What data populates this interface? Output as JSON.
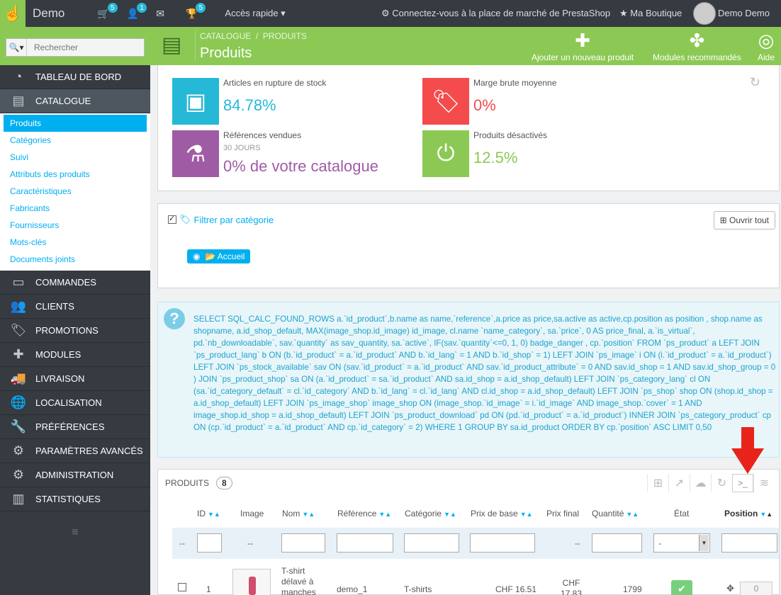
{
  "topbar": {
    "brand": "Demo",
    "cart_count": "5",
    "customers_count": "1",
    "trophy_count": "5",
    "quick_access": "Accès rapide",
    "marketplace": "Connectez-vous à la place de marché de PrestaShop",
    "my_shop": "Ma Boutique",
    "user": "Demo Demo"
  },
  "sidebar": {
    "search_placeholder": "Rechercher",
    "items": [
      {
        "label": "TABLEAU DE BORD",
        "icon": "dashboard-icon"
      },
      {
        "label": "CATALOGUE",
        "icon": "book-icon"
      },
      {
        "label": "COMMANDES",
        "icon": "credit-card-icon"
      },
      {
        "label": "CLIENTS",
        "icon": "users-icon"
      },
      {
        "label": "PROMOTIONS",
        "icon": "tags-icon"
      },
      {
        "label": "MODULES",
        "icon": "puzzle-icon"
      },
      {
        "label": "LIVRAISON",
        "icon": "truck-icon"
      },
      {
        "label": "LOCALISATION",
        "icon": "globe-icon"
      },
      {
        "label": "PRÉFÉRENCES",
        "icon": "wrench-icon"
      },
      {
        "label": "PARAMÈTRES AVANCÉS",
        "icon": "gears-icon"
      },
      {
        "label": "ADMINISTRATION",
        "icon": "gear-icon"
      },
      {
        "label": "STATISTIQUES",
        "icon": "bar-chart-icon"
      }
    ],
    "catalogue_sub": [
      "Produits",
      "Catégories",
      "Suivi",
      "Attributs des produits",
      "Caractéristiques",
      "Fabricants",
      "Fournisseurs",
      "Mots-clés",
      "Documents joints"
    ]
  },
  "header": {
    "bread_1": "CATALOGUE",
    "bread_sep": "/",
    "bread_2": "PRODUITS",
    "title": "Produits",
    "add_product": "Ajouter un nouveau produit",
    "modules": "Modules recommandés",
    "help": "Aide"
  },
  "kpis": {
    "out_of_stock_label": "Articles en rupture de stock",
    "out_of_stock_value": "84.78%",
    "margin_label": "Marge brute moyenne",
    "margin_value": "0%",
    "sold_label": "Références vendues",
    "sold_sub": "30 JOURS",
    "sold_value": "0% de votre catalogue",
    "disabled_label": "Produits désactivés",
    "disabled_value": "12.5%",
    "colors": {
      "blue": "#25b9d7",
      "red": "#f44c4c",
      "purple": "#a05ba5",
      "green": "#8bc954"
    }
  },
  "filter": {
    "label": "Filtrer par catégorie",
    "open_all": "Ouvrir tout",
    "root": "Accueil"
  },
  "sql": {
    "text": "SELECT SQL_CALC_FOUND_ROWS a.`id_product`,b.name as name,`reference`,a.price as price,sa.active as active,cp.position as position , shop.name as shopname, a.id_shop_default, MAX(image_shop.id_image) id_image, cl.name `name_category`, sa.`price`, 0 AS price_final, a.`is_virtual`, pd.`nb_downloadable`, sav.`quantity` as sav_quantity, sa.`active`, IF(sav.`quantity`<=0, 1, 0) badge_danger , cp.`position` FROM `ps_product` a LEFT JOIN `ps_product_lang` b ON (b.`id_product` = a.`id_product` AND b.`id_lang` = 1 AND b.`id_shop` = 1) LEFT JOIN `ps_image` i ON (i.`id_product` = a.`id_product`) LEFT JOIN `ps_stock_available` sav ON (sav.`id_product` = a.`id_product` AND sav.`id_product_attribute` = 0 AND sav.id_shop = 1 AND sav.id_shop_group = 0 ) JOIN `ps_product_shop` sa ON (a.`id_product` = sa.`id_product` AND sa.id_shop = a.id_shop_default) LEFT JOIN `ps_category_lang` cl ON (sa.`id_category_default` = cl.`id_category` AND b.`id_lang` = cl.`id_lang` AND cl.id_shop = a.id_shop_default) LEFT JOIN `ps_shop` shop ON (shop.id_shop = a.id_shop_default) LEFT JOIN `ps_image_shop` image_shop ON (image_shop.`id_image` = i.`id_image` AND image_shop.`cover` = 1 AND image_shop.id_shop = a.id_shop_default) LEFT JOIN `ps_product_download` pd ON (pd.`id_product` = a.`id_product`) INNER JOIN `ps_category_product` cp ON (cp.`id_product` = a.`id_product` AND cp.`id_category` = 2) WHERE 1 GROUP BY sa.id_product ORDER BY cp.`position` ASC LIMIT 0,50"
  },
  "products": {
    "title": "PRODUITS",
    "count": "8",
    "columns": [
      "ID",
      "Image",
      "Nom",
      "Référence",
      "Catégorie",
      "Prix de base",
      "Prix final",
      "Quantité",
      "État",
      "Position"
    ],
    "filter_dash": "--",
    "state_select": "-",
    "row": {
      "id": "1",
      "name": "T-shirt délavé à manches",
      "reference": "demo_1",
      "category": "T-shirts",
      "base_price": "CHF 16.51",
      "final_price": "CHF 17.83",
      "quantity": "1799",
      "position": "0"
    }
  }
}
